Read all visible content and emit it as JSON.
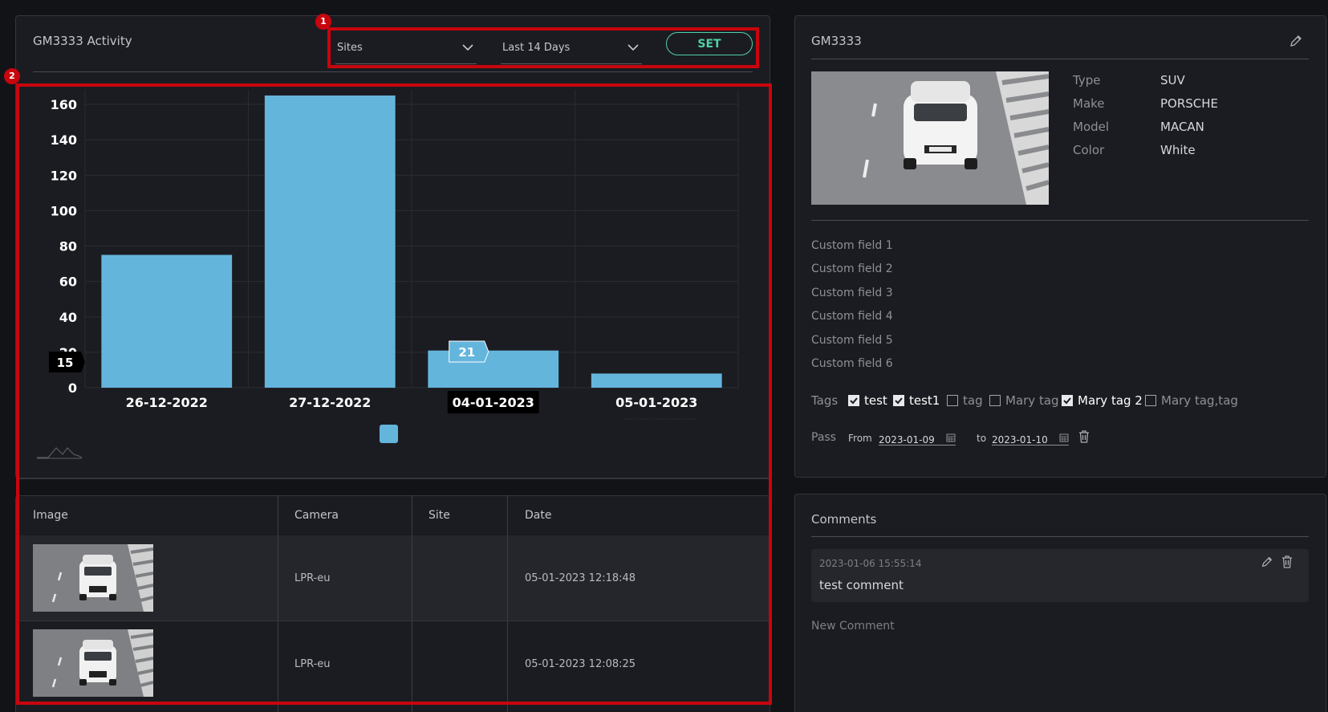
{
  "activity": {
    "title": "GM3333 Activity",
    "sites_select": "Sites",
    "range_select": "Last 14 Days",
    "set_label": "SET"
  },
  "annotations": {
    "badge1": "1",
    "badge2": "2"
  },
  "chart_data": {
    "type": "bar",
    "categories": [
      "26-12-2022",
      "27-12-2022",
      "04-01-2023",
      "05-01-2023"
    ],
    "values": [
      75,
      165,
      21,
      8
    ],
    "yticks": [
      0,
      20,
      40,
      60,
      80,
      100,
      120,
      140,
      160
    ],
    "ylim": [
      0,
      167
    ],
    "grid": true,
    "bar_color": "#64b5dc",
    "tooltip_value": "21",
    "y_hover_label": "15",
    "highlighted_category": "04-01-2023"
  },
  "table": {
    "headers": [
      "Image",
      "Camera",
      "Site",
      "Date"
    ],
    "rows": [
      {
        "camera": "LPR-eu",
        "site": "",
        "date": "05-01-2023 12:18:48"
      },
      {
        "camera": "LPR-eu",
        "site": "",
        "date": "05-01-2023 12:08:25"
      }
    ]
  },
  "vehicle": {
    "plate": "GM3333",
    "attributes": [
      {
        "key": "Type",
        "value": "SUV"
      },
      {
        "key": "Make",
        "value": "PORSCHE"
      },
      {
        "key": "Model",
        "value": "MACAN"
      },
      {
        "key": "Color",
        "value": "White"
      }
    ],
    "custom_fields": [
      "Custom field 1",
      "Custom field 2",
      "Custom field 3",
      "Custom field 4",
      "Custom field 5",
      "Custom field 6"
    ],
    "tags_label": "Tags",
    "tags": [
      {
        "label": "test",
        "checked": true
      },
      {
        "label": "test1",
        "checked": true
      },
      {
        "label": "tag",
        "checked": false
      },
      {
        "label": "Mary tag",
        "checked": false
      },
      {
        "label": "Mary tag 2",
        "checked": true
      },
      {
        "label": "Mary tag,tag",
        "checked": false
      }
    ],
    "pass": {
      "label": "Pass",
      "from_label": "From",
      "from_date": "2023-01-09",
      "to_label": "to",
      "to_date": "2023-01-10"
    }
  },
  "comments": {
    "title": "Comments",
    "items": [
      {
        "timestamp": "2023-01-06 15:55:14",
        "text": "test comment"
      }
    ],
    "new_placeholder": "New Comment"
  },
  "colors": {
    "accent": "#4fd1a5",
    "annotation": "#c8050e",
    "bar": "#64b5dc"
  }
}
